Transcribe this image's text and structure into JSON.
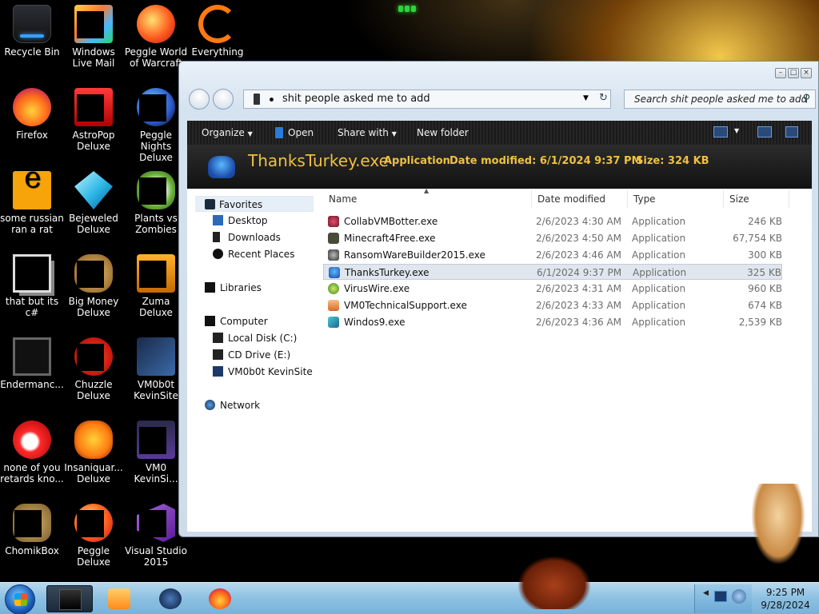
{
  "desktop": {
    "icons": [
      {
        "label": "Recycle Bin",
        "icon": "recycle-bin-icon"
      },
      {
        "label": "Windows Live Mail",
        "icon": "windows-live-mail-icon"
      },
      {
        "label": "Peggle World of Warcraft",
        "icon": "peggle-wow-icon"
      },
      {
        "label": "Everything",
        "icon": "everything-search-icon"
      },
      {
        "label": "Firefox",
        "icon": "firefox-icon"
      },
      {
        "label": "AstroPop Deluxe",
        "icon": "astropop-icon"
      },
      {
        "label": "Peggle Nights Deluxe",
        "icon": "peggle-nights-icon"
      },
      {
        "label": "some russian ran a rat",
        "icon": "shortcut-e-icon"
      },
      {
        "label": "Bejeweled Deluxe",
        "icon": "bejeweled-icon"
      },
      {
        "label": "Plants vs Zombies",
        "icon": "plants-vs-zombies-icon"
      },
      {
        "label": "that but its c#",
        "icon": "copy-shortcut-icon"
      },
      {
        "label": "Big Money Deluxe",
        "icon": "big-money-icon"
      },
      {
        "label": "Zuma Deluxe",
        "icon": "zuma-icon"
      },
      {
        "label": "Endermanc...",
        "icon": "endermanch-icon"
      },
      {
        "label": "Chuzzle Deluxe",
        "icon": "chuzzle-icon"
      },
      {
        "label": "VM0b0t KevinSite",
        "icon": "vm0b0t-site-icon"
      },
      {
        "label": "none of you retards kno...",
        "icon": "shortcut-red-icon"
      },
      {
        "label": "Insaniquar... Deluxe",
        "icon": "insaniquarium-icon"
      },
      {
        "label": "VM0 KevinSi...",
        "icon": "vm0-site-icon"
      },
      {
        "label": "ChomikBox",
        "icon": "chomikbox-icon"
      },
      {
        "label": "Peggle Deluxe",
        "icon": "peggle-deluxe-icon"
      },
      {
        "label": "Visual Studio 2015",
        "icon": "visual-studio-icon"
      }
    ]
  },
  "window": {
    "address_path": "shit people asked me to add",
    "search_placeholder": "Search shit people asked me to add",
    "toolbar": {
      "organize": "Organize",
      "open": "Open",
      "share_with": "Share with",
      "new_folder": "New folder"
    },
    "details": {
      "file_name": "ThanksTurkey.exe",
      "type": "Application",
      "date_modified": "Date modified: 6/1/2024 9:37 PM",
      "size": "Size: 324 KB"
    },
    "nav": {
      "favorites": "Favorites",
      "desktop": "Desktop",
      "downloads": "Downloads",
      "recent_places": "Recent Places",
      "libraries": "Libraries",
      "computer": "Computer",
      "local_disk": "Local Disk (C:)",
      "cd_drive": "CD Drive (E:)",
      "vm_drive": "VM0b0t KevinSite",
      "network": "Network"
    },
    "columns": {
      "name": "Name",
      "date_modified": "Date modified",
      "type": "Type",
      "size": "Size"
    },
    "files": [
      {
        "name": "CollabVMBotter.exe",
        "date": "2/6/2023 4:30 AM",
        "type": "Application",
        "size": "246 KB"
      },
      {
        "name": "Minecraft4Free.exe",
        "date": "2/6/2023 4:50 AM",
        "type": "Application",
        "size": "67,754 KB"
      },
      {
        "name": "RansomWareBuilder2015.exe",
        "date": "2/6/2023 4:46 AM",
        "type": "Application",
        "size": "300 KB"
      },
      {
        "name": "ThanksTurkey.exe",
        "date": "6/1/2024 9:37 PM",
        "type": "Application",
        "size": "325 KB"
      },
      {
        "name": "VirusWire.exe",
        "date": "2/6/2023 4:31 AM",
        "type": "Application",
        "size": "960 KB"
      },
      {
        "name": "VM0TechnicalSupport.exe",
        "date": "2/6/2023 4:33 AM",
        "type": "Application",
        "size": "674 KB"
      },
      {
        "name": "Windos9.exe",
        "date": "2/6/2023 4:36 AM",
        "type": "Application",
        "size": "2,539 KB"
      }
    ],
    "selected_file": "ThanksTurkey.exe"
  },
  "taskbar": {
    "time": "9:25 PM",
    "date": "9/28/2024"
  },
  "colors": {
    "details_text": "#f0c040",
    "taskbar": "#8cc0e2",
    "selection": "#dfe6ee"
  }
}
